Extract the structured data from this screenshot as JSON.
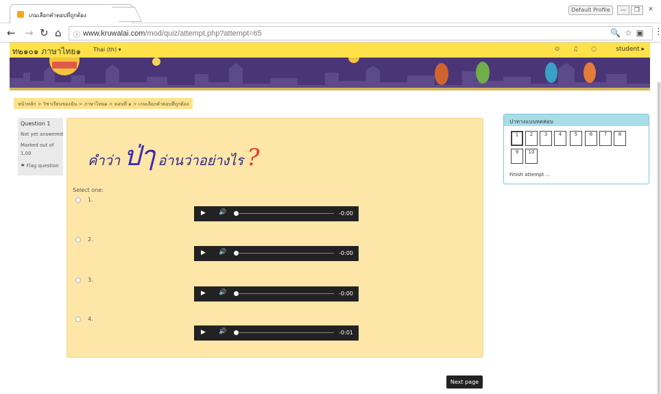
{
  "browser": {
    "tab_title": "เกมเลือกคำตอบที่ถูกต้อง",
    "tab_close": "×",
    "profile_label": "Default Profile",
    "window_buttons": [
      "—",
      "❐",
      "✕"
    ],
    "url_host": "www.kruwalai.com",
    "url_path": "/mod/quiz/attempt.php?attempt=65",
    "info_icon": "ⓘ"
  },
  "site": {
    "course_name": "ท๒๑๐๑ ภาษาไทย๑",
    "language": "Thai (th) ▾",
    "user": "student ▸"
  },
  "breadcrumb": "หน้าหลัก > วิชาเรียนของฉัน > ภาษาไทย๑ > ตอนที่ ๑ > เกมเลือกคำตอบที่ถูกต้อง",
  "question_info": {
    "label": "Question 1",
    "state": "Not yet answered",
    "marked": "Marked out of",
    "marks": "1.00",
    "flag": "Flag question"
  },
  "question": {
    "prefix": "คำว่า",
    "word": "ป่ๅ",
    "suffix": "อ่านว่าอย่างไร",
    "qmark": "?",
    "select_one": "Select one:",
    "options": [
      {
        "label": "1.",
        "time": "-0:00"
      },
      {
        "label": "2.",
        "time": "-0:00"
      },
      {
        "label": "3.",
        "time": "-0:00"
      },
      {
        "label": "4.",
        "time": "-0:01"
      }
    ]
  },
  "quiz_nav": {
    "title": "ปาทางแบบทดสอบ",
    "buttons": [
      "1",
      "2",
      "3",
      "4",
      "5",
      "6",
      "7",
      "8",
      "9",
      "10"
    ],
    "finish": "Finish attempt ..."
  },
  "next_page": "Next page"
}
